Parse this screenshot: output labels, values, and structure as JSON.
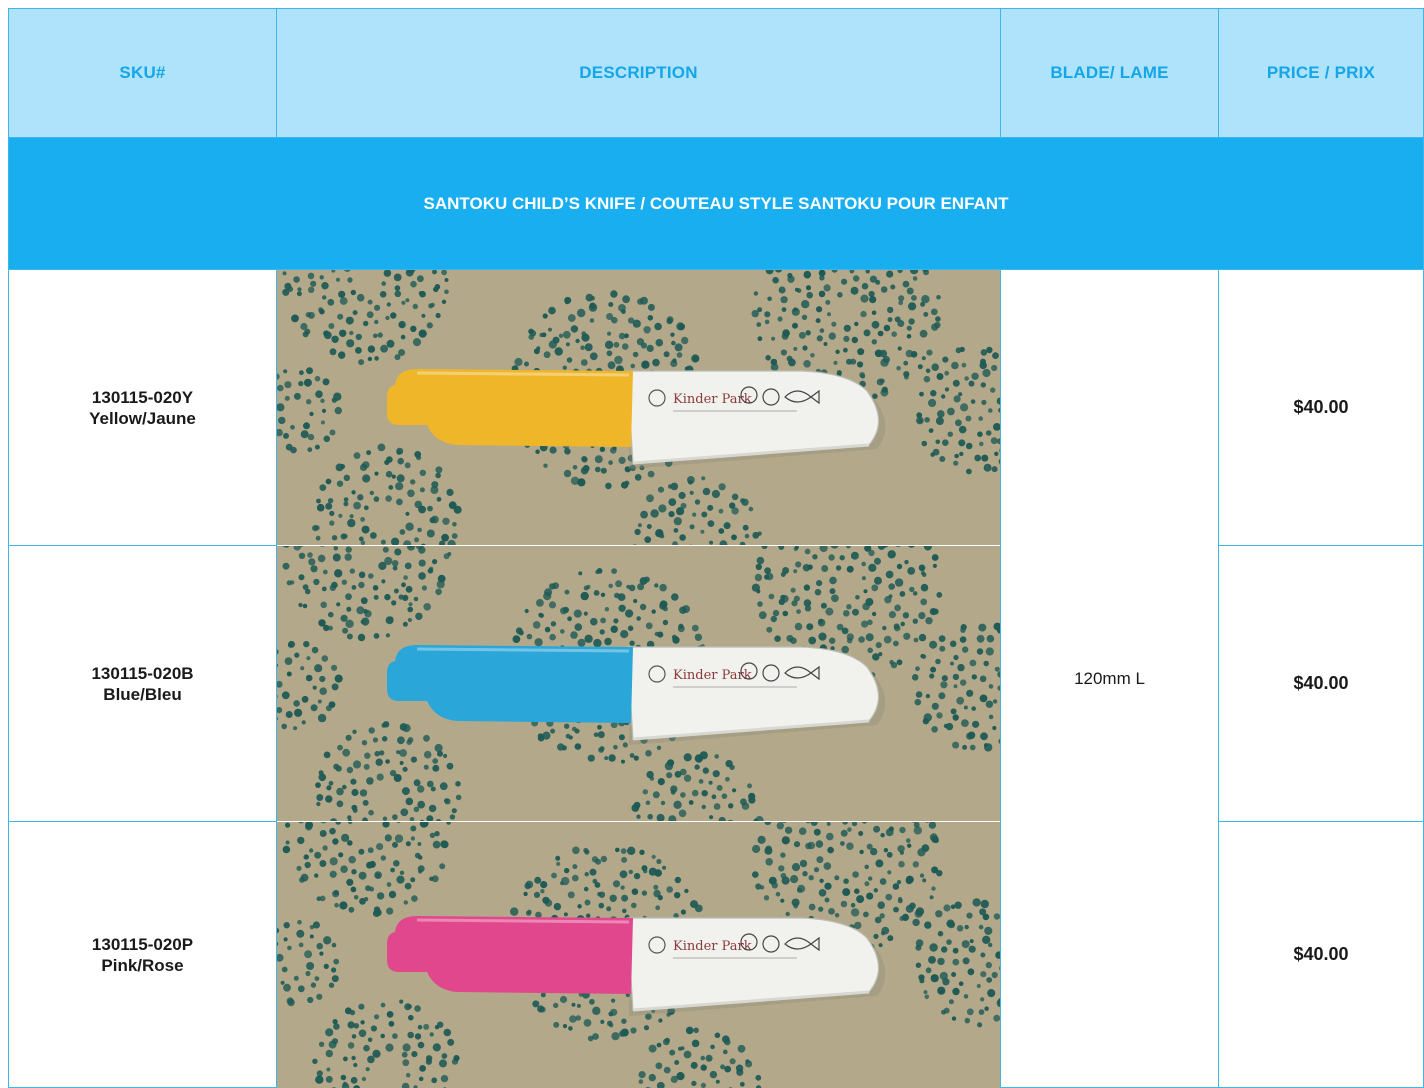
{
  "header": {
    "sku": "SKU#",
    "description": "DESCRIPTION",
    "blade": "BLADE/ LAME",
    "price": "PRICE / PRIX"
  },
  "section_title": "SANTOKU CHILD’S KNIFE / COUTEAU STYLE SANTOKU POUR ENFANT",
  "blade_value": "120mm L",
  "blade_brand": "Kinder Park",
  "rows": [
    {
      "sku": "130115-020Y",
      "color_name": "Yellow/Jaune",
      "price": "$40.00",
      "handle_color": "#f0b62a"
    },
    {
      "sku": "130115-020B",
      "color_name": "Blue/Bleu",
      "price": "$40.00",
      "handle_color": "#2aa6d8"
    },
    {
      "sku": "130115-020P",
      "color_name": "Pink/Rose",
      "price": "$40.00",
      "handle_color": "#e0478c"
    }
  ],
  "colors": {
    "border": "#3fb6e6",
    "header_bg": "#aee3fb",
    "header_text": "#14a6e8",
    "section_bg": "#18aef0",
    "photo_bg": "#b3a98a",
    "dots": "#1f5a55"
  }
}
